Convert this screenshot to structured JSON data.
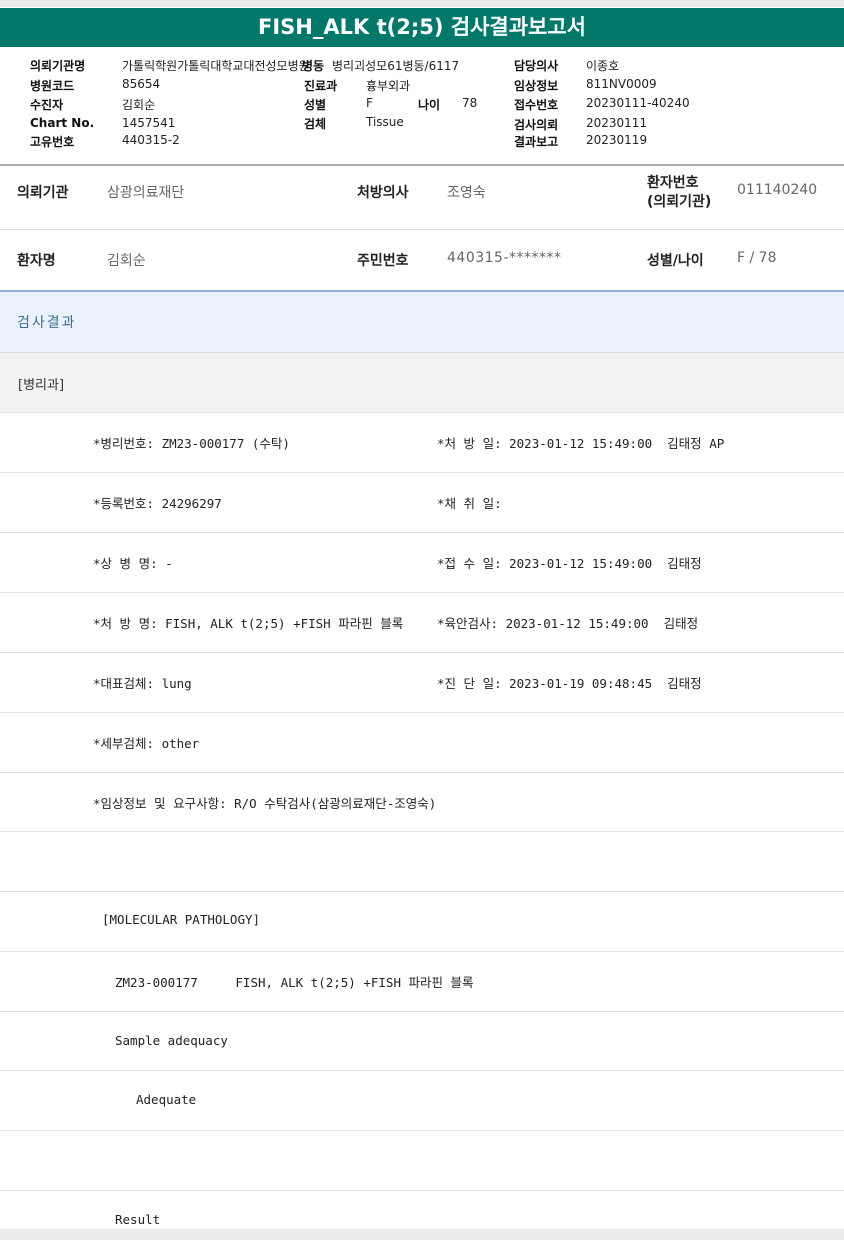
{
  "title": "FISH_ALK t(2;5) 검사결과보고서",
  "header": {
    "request_org_label": "의뢰기관명",
    "request_org_value": "가톨릭학원가톨릭대학교대전성모병원",
    "ward_label": "병동",
    "ward_value": "병리괴성모61병동/6117",
    "doctor_label": "담당의사",
    "doctor_value": "이종호",
    "hospital_code_label": "병원코드",
    "hospital_code_value": "85654",
    "dept_label": "진료과",
    "dept_value": "흉부외과",
    "clinical_label": "임상정보",
    "clinical_value": "811NV0009",
    "patient_label": "수진자",
    "patient_value": "김회순",
    "sex_label": "성별",
    "sex_value": "F",
    "age_label": "나이",
    "age_value": "78",
    "receipt_label": "접수번호",
    "receipt_value": "20230111-40240",
    "chart_label": "Chart No.",
    "chart_value": "1457541",
    "specimen_label": "검체",
    "specimen_value": "Tissue",
    "exam_req_label": "검사의뢰",
    "exam_req_value": "20230111",
    "unique_label": "고유번호",
    "unique_value": "440315-2",
    "report_label": "결과보고",
    "report_value": "20230119"
  },
  "patient_info": {
    "org_label": "의뢰기관",
    "org_value": "삼광의료재단",
    "doctor_label": "처방의사",
    "doctor_value": "조영숙",
    "patno_label_1": "환자번호",
    "patno_label_2": "(의뢰기관)",
    "patno_value": "011140240",
    "name_label": "환자명",
    "name_value": "김회순",
    "rrn_label": "주민번호",
    "rrn_value": "440315-*******",
    "sexage_label": "성별/나이",
    "sexage_value": "F / 78"
  },
  "result_title": "검사결과",
  "dept_section": "[병리과]",
  "rows": {
    "r1_left": "*병리번호: ZM23-000177 (수탁)",
    "r1_right": "*처 방 일: 2023-01-12 15:49:00  김태정 AP",
    "r2_left": "*등록번호: 24296297",
    "r2_right": "*채 취 일:",
    "r3_left": "*상 병 명: -",
    "r3_right": "*접 수 일: 2023-01-12 15:49:00  김태정",
    "r4_left": "*처 방 명: FISH, ALK t(2;5) +FISH 파라핀 블록",
    "r4_right": "*육안검사: 2023-01-12 15:49:00  김태정",
    "r5_left": "*대표검체: lung",
    "r5_right": "*진 단 일: 2023-01-19 09:48:45  김태정",
    "r6_left": "*세부검체: other",
    "r7_left": "*임상정보 및 요구사항: R/O 수탁검사(삼광의료재단-조영숙)",
    "r9": "[MOLECULAR PATHOLOGY]",
    "r10": "ZM23-000177     FISH, ALK t(2;5) +FISH 파라핀 블록",
    "r11": "Sample adequacy",
    "r12": "Adequate",
    "r14": "Result"
  }
}
